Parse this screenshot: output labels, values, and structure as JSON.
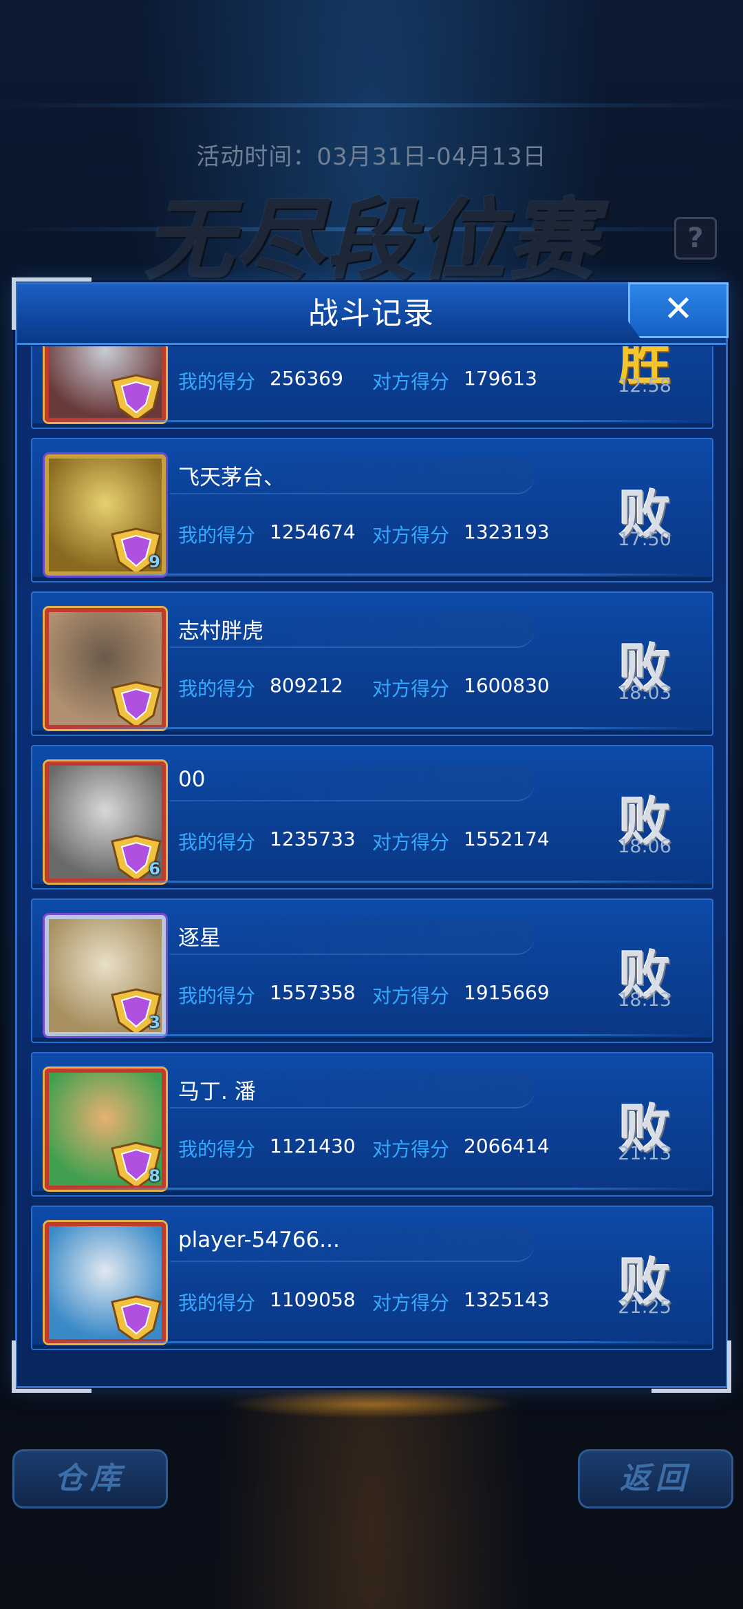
{
  "activity_time": "活动时间：03月31日-04月13日",
  "event_title": "无尽段位赛",
  "help_label": "?",
  "panel": {
    "title": "战斗记录",
    "close_label": "✕"
  },
  "score_labels": {
    "mine": "我的得分",
    "opponent": "对方得分"
  },
  "records": [
    {
      "name": "",
      "my_score": "256369",
      "opp_score": "179613",
      "result": "胜",
      "time": "12:58",
      "rank": "",
      "frame": "red"
    },
    {
      "name": "飞天茅台、",
      "my_score": "1254674",
      "opp_score": "1323193",
      "result": "败",
      "time": "17:50",
      "rank": "9",
      "frame": "gold"
    },
    {
      "name": "志村胖虎",
      "my_score": "809212",
      "opp_score": "1600830",
      "result": "败",
      "time": "18:03",
      "rank": "",
      "frame": "red"
    },
    {
      "name": "00",
      "my_score": "1235733",
      "opp_score": "1552174",
      "result": "败",
      "time": "18:06",
      "rank": "6",
      "frame": "red"
    },
    {
      "name": "逐星",
      "my_score": "1557358",
      "opp_score": "1915669",
      "result": "败",
      "time": "18:13",
      "rank": "3",
      "frame": "silver"
    },
    {
      "name": "马丁. 潘",
      "my_score": "1121430",
      "opp_score": "2066414",
      "result": "败",
      "time": "21:13",
      "rank": "8",
      "frame": "red"
    },
    {
      "name": "player-54766...",
      "my_score": "1109058",
      "opp_score": "1325143",
      "result": "败",
      "time": "21:25",
      "rank": "",
      "frame": "red"
    }
  ],
  "bottom": {
    "warehouse": "仓库",
    "back": "返回"
  }
}
